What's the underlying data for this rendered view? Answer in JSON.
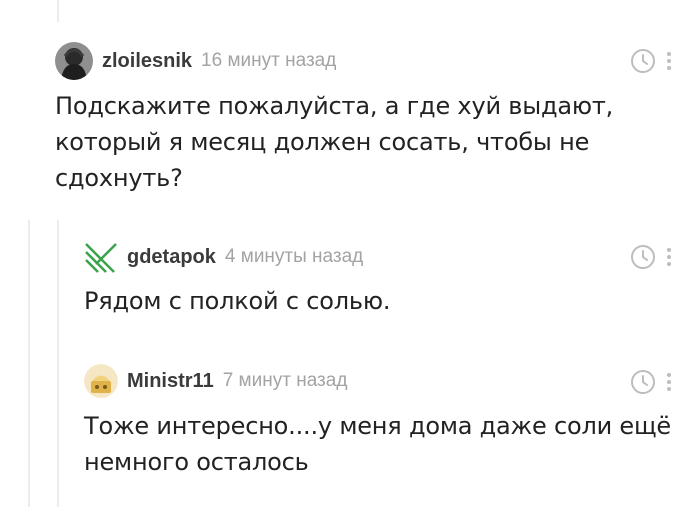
{
  "comments": [
    {
      "username": "zloilesnik",
      "time": "16 минут назад",
      "text_lines": [
        "Подскажите пожалуйста, а где хуй выдают,",
        "который я месяц должен сосать, чтобы не",
        "сдохнуть?"
      ],
      "avatar_icon": "hooded-figure-avatar",
      "actions": {
        "save_icon": "clock-icon",
        "more_icon": "more-vertical-icon"
      }
    },
    {
      "username": "gdetapok",
      "time": "4 минуты назад",
      "text_lines": [
        "Рядом с полкой с солью."
      ],
      "avatar_icon": "green-stripes-avatar",
      "actions": {
        "save_icon": "clock-icon",
        "more_icon": "more-vertical-icon"
      }
    },
    {
      "username": "Ministr11",
      "time": "7 минут назад",
      "text_lines": [
        "Тоже интересно....у меня дома даже соли ещё",
        "немного осталось"
      ],
      "avatar_icon": "cartoon-avatar",
      "actions": {
        "save_icon": "clock-icon",
        "more_icon": "more-vertical-icon"
      }
    }
  ],
  "colors": {
    "thread_line": "#ececec",
    "username": "#3b3b3b",
    "time": "#a3a3a3",
    "icon": "#bdbdbd",
    "accent_green": "#3aa34a"
  }
}
